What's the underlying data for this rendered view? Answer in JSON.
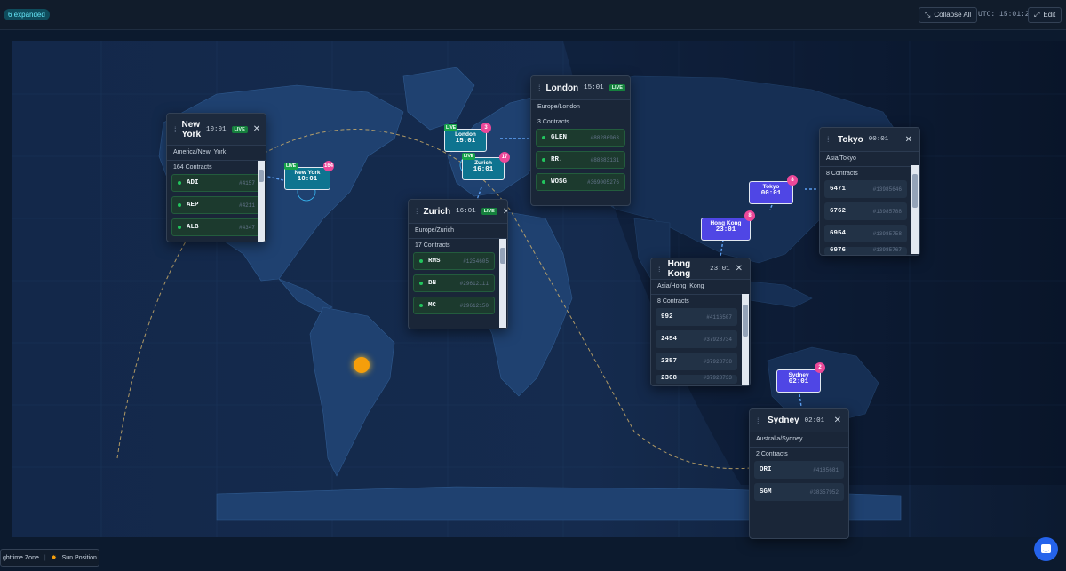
{
  "topbar": {
    "expanded_label": "6 expanded",
    "collapse_label": "Collapse All",
    "utc_label": "UTC: 15:01:25",
    "edit_label": "Edit"
  },
  "legend": {
    "night_label": "ghttime Zone",
    "sun_label": "Sun Position"
  },
  "markers": {
    "new_york": {
      "city": "New York",
      "time": "10:01",
      "count": "164",
      "live": "LIVE"
    },
    "london": {
      "city": "London",
      "time": "15:01",
      "count": "3",
      "live": "LIVE"
    },
    "zurich": {
      "city": "Zurich",
      "time": "16:01",
      "count": "17",
      "live": "LIVE"
    },
    "tokyo": {
      "city": "Tokyo",
      "time": "00:01",
      "count": "8"
    },
    "hong_kong": {
      "city": "Hong Kong",
      "time": "23:01",
      "count": "8"
    },
    "sydney": {
      "city": "Sydney",
      "time": "02:01",
      "count": "2"
    }
  },
  "panels": {
    "new_york": {
      "city": "New York",
      "time": "10:01",
      "live": "LIVE",
      "timezone": "America/New_York",
      "count_label": "164 Contracts",
      "rows": [
        {
          "symbol": "ADI",
          "id": "#4157"
        },
        {
          "symbol": "AEP",
          "id": "#4211"
        },
        {
          "symbol": "ALB",
          "id": "#4347"
        }
      ]
    },
    "london": {
      "city": "London",
      "time": "15:01",
      "live": "LIVE",
      "timezone": "Europe/London",
      "count_label": "3 Contracts",
      "rows": [
        {
          "symbol": "GLEN",
          "id": "#88286963"
        },
        {
          "symbol": "RR.",
          "id": "#88383131"
        },
        {
          "symbol": "WOSG",
          "id": "#369005276"
        }
      ]
    },
    "zurich": {
      "city": "Zurich",
      "time": "16:01",
      "live": "LIVE",
      "timezone": "Europe/Zurich",
      "count_label": "17 Contracts",
      "rows": [
        {
          "symbol": "RMS",
          "id": "#1254605"
        },
        {
          "symbol": "BN",
          "id": "#29612111"
        },
        {
          "symbol": "MC",
          "id": "#29612150"
        }
      ]
    },
    "tokyo": {
      "city": "Tokyo",
      "time": "00:01",
      "timezone": "Asia/Tokyo",
      "count_label": "8 Contracts",
      "rows": [
        {
          "symbol": "6471",
          "id": "#13985646"
        },
        {
          "symbol": "6762",
          "id": "#13985788"
        },
        {
          "symbol": "6954",
          "id": "#13985758"
        },
        {
          "symbol": "6976",
          "id": "#13985767"
        }
      ]
    },
    "hong_kong": {
      "city": "Hong Kong",
      "time": "23:01",
      "timezone": "Asia/Hong_Kong",
      "count_label": "8 Contracts",
      "rows": [
        {
          "symbol": "992",
          "id": "#4116507"
        },
        {
          "symbol": "2454",
          "id": "#37928734"
        },
        {
          "symbol": "2357",
          "id": "#37928738"
        },
        {
          "symbol": "2308",
          "id": "#37928733"
        }
      ]
    },
    "sydney": {
      "city": "Sydney",
      "time": "02:01",
      "timezone": "Australia/Sydney",
      "count_label": "2 Contracts",
      "rows": [
        {
          "symbol": "ORI",
          "id": "#4185681"
        },
        {
          "symbol": "SGM",
          "id": "#38357952"
        }
      ]
    }
  }
}
